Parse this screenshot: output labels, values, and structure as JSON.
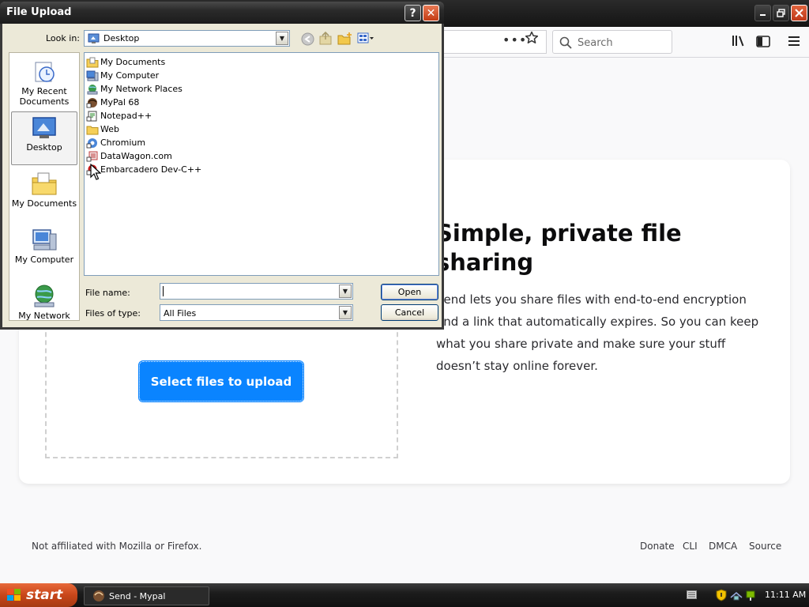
{
  "browser": {
    "search_placeholder": "Search"
  },
  "page": {
    "hero_title": "Simple, private file sharing",
    "hero_description": "Send lets you share files with end-to-end encryption and a link that automatically expires. So you can keep what you share private and make sure your stuff doesn’t stay online forever.",
    "select_files_label": "Select files to upload",
    "footer": {
      "note": "Not affiliated with Mozilla or Firefox.",
      "links": [
        "Donate",
        "CLI",
        "DMCA",
        "Source"
      ]
    }
  },
  "dialog": {
    "title": "File Upload",
    "look_in_label": "Look in:",
    "look_in_value": "Desktop",
    "places": [
      {
        "label": "My Recent Documents",
        "icon": "recent-documents-icon"
      },
      {
        "label": "Desktop",
        "icon": "desktop-icon",
        "selected": true
      },
      {
        "label": "My Documents",
        "icon": "my-documents-icon"
      },
      {
        "label": "My Computer",
        "icon": "my-computer-icon"
      },
      {
        "label": "My Network",
        "icon": "my-network-icon"
      }
    ],
    "files": [
      {
        "name": "My Documents",
        "icon": "folder-documents-icon"
      },
      {
        "name": "My Computer",
        "icon": "computer-icon"
      },
      {
        "name": "My Network Places",
        "icon": "network-places-icon"
      },
      {
        "name": "MyPal 68",
        "icon": "shortcut-mypal-icon"
      },
      {
        "name": "Notepad++",
        "icon": "shortcut-notepad-icon"
      },
      {
        "name": "Web",
        "icon": "folder-icon"
      },
      {
        "name": "Chromium",
        "icon": "shortcut-chromium-icon"
      },
      {
        "name": "DataWagon.com",
        "icon": "shortcut-datawagon-icon"
      },
      {
        "name": "Embarcadero Dev-C++",
        "icon": "shortcut-devcpp-icon"
      }
    ],
    "file_name_label": "File name:",
    "file_name_value": "",
    "files_of_type_label": "Files of type:",
    "files_of_type_value": "All Files",
    "open_label": "Open",
    "cancel_label": "Cancel",
    "help_label": "?",
    "close_label": "✕"
  },
  "taskbar": {
    "start_label": "start",
    "task_label": "Send - Mypal",
    "clock": "11:11 AM"
  }
}
